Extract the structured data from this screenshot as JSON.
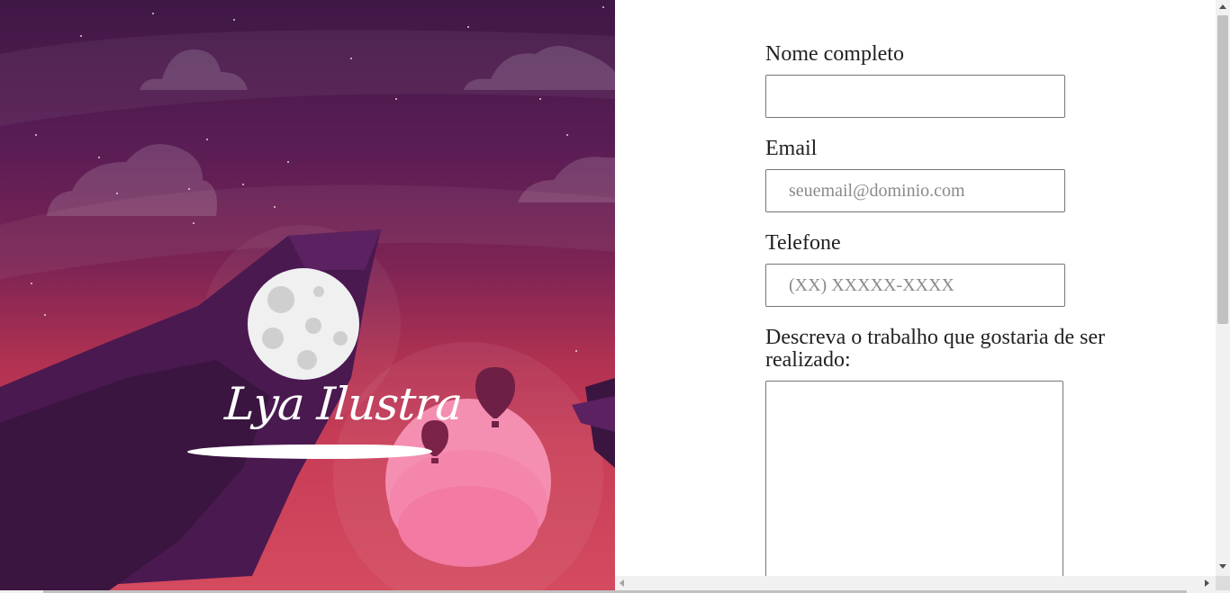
{
  "brand": {
    "logo_text": "Lya Ilustra"
  },
  "form": {
    "name_label": "Nome completo",
    "name_value": "",
    "name_placeholder": "",
    "email_label": "Email",
    "email_placeholder": "seuemail@dominio.com",
    "phone_label": "Telefone",
    "phone_placeholder": "(XX) XXXXX-XXXX",
    "description_label": "Descreva o trabalho que gostaria de ser realizado:",
    "description_value": ""
  },
  "colors": {
    "sky_top": "#3f1846",
    "sky_mid": "#7d2454",
    "sky_bottom": "#d44a5e",
    "cliff": "#3a1540",
    "moon": "#f0f0f0",
    "planet": "#f48fb1",
    "balloon": "#6e1f45"
  },
  "icons": {
    "moon": "moon-illustration",
    "balloon": "hot-air-balloon-illustration",
    "cloud": "cloud-illustration"
  }
}
